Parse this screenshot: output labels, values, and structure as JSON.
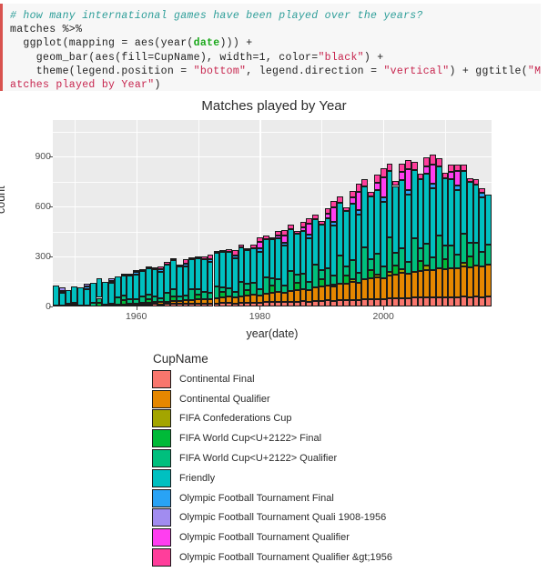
{
  "code": {
    "lines": [
      [
        {
          "t": "# how many international games have been played over the years?",
          "c": "cm"
        }
      ],
      [
        {
          "t": "matches %>%",
          "c": ""
        }
      ],
      [
        {
          "t": "  ggplot(mapping = aes(year(",
          "c": ""
        },
        {
          "t": "date",
          "c": "fn"
        },
        {
          "t": "))) +",
          "c": ""
        }
      ],
      [
        {
          "t": "    geom_bar(aes(fill=CupName), width=1, color=",
          "c": ""
        },
        {
          "t": "\"black\"",
          "c": "st"
        },
        {
          "t": ") +",
          "c": ""
        }
      ],
      [
        {
          "t": "    theme(legend.position = ",
          "c": ""
        },
        {
          "t": "\"bottom\"",
          "c": "st"
        },
        {
          "t": ", legend.direction = ",
          "c": ""
        },
        {
          "t": "\"vertical\"",
          "c": "st"
        },
        {
          "t": ") + ggtitle(",
          "c": ""
        },
        {
          "t": "\"M",
          "c": "st"
        }
      ],
      [
        {
          "t": "atches played by Year\"",
          "c": "st"
        },
        {
          "t": ")",
          "c": ""
        }
      ]
    ]
  },
  "chart_data": {
    "type": "bar",
    "barmode": "stacked",
    "title": "Matches played by Year",
    "xlabel": "year(date)",
    "ylabel": "count",
    "xlim": [
      1946.5,
      2017.5
    ],
    "ylim": [
      0,
      1120
    ],
    "yticks": [
      0,
      300,
      600,
      900
    ],
    "ytick_labels": [
      "0",
      "300",
      "600",
      "900"
    ],
    "xticks": [
      1960,
      1980,
      2000
    ],
    "xtick_labels": [
      "1960",
      "1980",
      "2000"
    ],
    "grid": true,
    "legend_position": "bottom",
    "legend_direction": "vertical",
    "legend_title": "CupName",
    "series": [
      {
        "name": "Continental Final",
        "color": "#F8766D"
      },
      {
        "name": "Continental Qualifier",
        "color": "#E58700"
      },
      {
        "name": "FIFA Confederations Cup",
        "color": "#A3A500"
      },
      {
        "name": "FIFA World Cup<U+2122> Final",
        "color": "#00BA38"
      },
      {
        "name": "FIFA World Cup<U+2122> Qualifier",
        "color": "#00BF7D"
      },
      {
        "name": "Friendly",
        "color": "#00C0C0"
      },
      {
        "name": "Olympic Football Tournament Final",
        "color": "#29A3F5"
      },
      {
        "name": "Olympic Football Tournament Quali 1908-1956",
        "color": "#A18CF0"
      },
      {
        "name": "Olympic Football Tournament Qualifier",
        "color": "#FF3EF0"
      },
      {
        "name": "Olympic Football Tournament Qualifier &gt;1956",
        "color": "#FF3E9B"
      }
    ],
    "categories": [
      1947,
      1948,
      1949,
      1950,
      1951,
      1952,
      1953,
      1954,
      1955,
      1956,
      1957,
      1958,
      1959,
      1960,
      1961,
      1962,
      1963,
      1964,
      1965,
      1966,
      1967,
      1968,
      1969,
      1970,
      1971,
      1972,
      1973,
      1974,
      1975,
      1976,
      1977,
      1978,
      1979,
      1980,
      1981,
      1982,
      1983,
      1984,
      1985,
      1986,
      1987,
      1988,
      1989,
      1990,
      1991,
      1992,
      1993,
      1994,
      1995,
      1996,
      1997,
      1998,
      1999,
      2000,
      2001,
      2002,
      2003,
      2004,
      2005,
      2006,
      2007,
      2008,
      2009,
      2010,
      2011,
      2012,
      2013,
      2014,
      2015,
      2016,
      2017
    ],
    "values": {
      "1947": [
        0,
        0,
        0,
        0,
        6,
        120,
        0,
        0,
        0,
        0
      ],
      "1948": [
        0,
        0,
        0,
        0,
        4,
        80,
        10,
        22,
        0,
        0
      ],
      "1949": [
        0,
        0,
        0,
        4,
        14,
        82,
        0,
        0,
        0,
        0
      ],
      "1950": [
        0,
        0,
        0,
        12,
        8,
        100,
        0,
        0,
        0,
        0
      ],
      "1951": [
        0,
        0,
        0,
        0,
        6,
        108,
        0,
        0,
        0,
        0
      ],
      "1952": [
        0,
        0,
        0,
        0,
        6,
        96,
        18,
        16,
        0,
        0
      ],
      "1953": [
        0,
        0,
        0,
        0,
        22,
        118,
        0,
        0,
        0,
        0
      ],
      "1954": [
        0,
        0,
        0,
        22,
        30,
        120,
        0,
        0,
        0,
        0
      ],
      "1955": [
        0,
        0,
        0,
        0,
        12,
        134,
        0,
        0,
        0,
        0
      ],
      "1956": [
        6,
        0,
        0,
        0,
        10,
        128,
        10,
        14,
        0,
        0
      ],
      "1957": [
        6,
        6,
        0,
        0,
        44,
        122,
        0,
        0,
        0,
        0
      ],
      "1958": [
        8,
        4,
        0,
        28,
        24,
        124,
        0,
        0,
        0,
        4
      ],
      "1959": [
        10,
        6,
        0,
        0,
        28,
        140,
        0,
        0,
        0,
        6
      ],
      "1960": [
        10,
        8,
        0,
        0,
        26,
        150,
        12,
        0,
        0,
        14
      ],
      "1961": [
        12,
        10,
        0,
        0,
        40,
        152,
        0,
        0,
        0,
        8
      ],
      "1962": [
        12,
        10,
        0,
        24,
        26,
        158,
        0,
        0,
        0,
        6
      ],
      "1963": [
        14,
        14,
        0,
        0,
        34,
        164,
        0,
        0,
        0,
        10
      ],
      "1964": [
        12,
        14,
        0,
        0,
        22,
        160,
        16,
        0,
        0,
        18
      ],
      "1965": [
        14,
        16,
        0,
        0,
        52,
        172,
        0,
        0,
        0,
        16
      ],
      "1966": [
        14,
        18,
        0,
        28,
        44,
        176,
        0,
        0,
        0,
        10
      ],
      "1967": [
        16,
        18,
        0,
        0,
        24,
        184,
        0,
        0,
        0,
        12
      ],
      "1968": [
        14,
        22,
        0,
        0,
        28,
        176,
        16,
        0,
        0,
        26
      ],
      "1969": [
        16,
        24,
        0,
        0,
        62,
        180,
        0,
        0,
        0,
        14
      ],
      "1970": [
        16,
        26,
        0,
        28,
        34,
        186,
        0,
        0,
        0,
        8
      ],
      "1971": [
        18,
        28,
        0,
        0,
        40,
        196,
        0,
        0,
        0,
        16
      ],
      "1972": [
        16,
        30,
        0,
        0,
        34,
        188,
        16,
        0,
        0,
        30
      ],
      "1973": [
        18,
        32,
        0,
        0,
        70,
        200,
        0,
        0,
        0,
        14
      ],
      "1974": [
        20,
        34,
        0,
        32,
        30,
        210,
        0,
        0,
        0,
        10
      ],
      "1975": [
        20,
        38,
        0,
        0,
        52,
        216,
        0,
        0,
        0,
        18
      ],
      "1976": [
        18,
        36,
        0,
        0,
        34,
        200,
        16,
        0,
        0,
        34
      ],
      "1977": [
        22,
        40,
        0,
        0,
        86,
        208,
        0,
        0,
        0,
        18
      ],
      "1978": [
        22,
        42,
        0,
        32,
        38,
        206,
        0,
        0,
        0,
        12
      ],
      "1979": [
        24,
        46,
        0,
        0,
        70,
        212,
        0,
        0,
        0,
        22
      ],
      "1980": [
        22,
        44,
        0,
        0,
        40,
        224,
        18,
        0,
        40,
        26
      ],
      "1981": [
        26,
        50,
        0,
        0,
        98,
        230,
        0,
        0,
        0,
        20
      ],
      "1982": [
        26,
        54,
        0,
        44,
        44,
        236,
        0,
        0,
        0,
        14
      ],
      "1983": [
        28,
        58,
        0,
        0,
        80,
        244,
        0,
        0,
        18,
        24
      ],
      "1984": [
        26,
        56,
        0,
        0,
        46,
        238,
        18,
        0,
        44,
        30
      ],
      "1985": [
        30,
        64,
        0,
        0,
        118,
        252,
        0,
        0,
        0,
        26
      ],
      "1986": [
        30,
        68,
        0,
        44,
        48,
        248,
        0,
        0,
        0,
        18
      ],
      "1987": [
        32,
        72,
        0,
        0,
        94,
        256,
        0,
        0,
        24,
        28
      ],
      "1988": [
        30,
        70,
        0,
        0,
        50,
        260,
        20,
        0,
        66,
        34
      ],
      "1989": [
        34,
        80,
        0,
        0,
        140,
        270,
        0,
        0,
        0,
        30
      ],
      "1990": [
        34,
        84,
        0,
        46,
        52,
        276,
        0,
        0,
        0,
        20
      ],
      "1991": [
        36,
        88,
        0,
        0,
        108,
        296,
        0,
        0,
        30,
        34
      ],
      "1992": [
        34,
        86,
        12,
        0,
        56,
        300,
        22,
        0,
        86,
        40
      ],
      "1993": [
        38,
        96,
        0,
        0,
        170,
        320,
        0,
        0,
        0,
        36
      ],
      "1994": [
        38,
        100,
        0,
        46,
        58,
        330,
        0,
        0,
        0,
        24
      ],
      "1995": [
        40,
        106,
        16,
        0,
        116,
        340,
        0,
        0,
        36,
        40
      ],
      "1996": [
        38,
        104,
        0,
        0,
        62,
        350,
        24,
        0,
        112,
        46
      ],
      "1997": [
        44,
        120,
        0,
        0,
        190,
        368,
        0,
        0,
        0,
        42
      ],
      "1998": [
        44,
        124,
        0,
        52,
        66,
        376,
        0,
        0,
        0,
        28
      ],
      "1999": [
        46,
        130,
        18,
        0,
        124,
        384,
        0,
        0,
        40,
        48
      ],
      "2000": [
        44,
        128,
        0,
        0,
        70,
        388,
        26,
        0,
        120,
        52
      ],
      "2001": [
        48,
        140,
        20,
        0,
        206,
        400,
        0,
        0,
        0,
        46
      ],
      "2002": [
        48,
        144,
        0,
        56,
        72,
        404,
        0,
        0,
        0,
        30
      ],
      "2003": [
        50,
        150,
        22,
        0,
        130,
        410,
        0,
        0,
        44,
        50
      ],
      "2004": [
        48,
        148,
        0,
        0,
        74,
        404,
        26,
        0,
        124,
        54
      ],
      "2005": [
        52,
        158,
        0,
        0,
        200,
        412,
        0,
        0,
        0,
        48
      ],
      "2006": [
        52,
        162,
        0,
        58,
        76,
        416,
        0,
        0,
        0,
        32
      ],
      "2007": [
        54,
        166,
        24,
        0,
        134,
        420,
        0,
        0,
        46,
        52
      ],
      "2008": [
        52,
        164,
        0,
        0,
        78,
        414,
        28,
        0,
        118,
        56
      ],
      "2009": [
        56,
        172,
        0,
        0,
        196,
        418,
        0,
        0,
        0,
        50
      ],
      "2010": [
        54,
        170,
        0,
        60,
        80,
        404,
        0,
        0,
        0,
        34
      ],
      "2011": [
        56,
        176,
        0,
        0,
        136,
        398,
        0,
        0,
        44,
        44
      ],
      "2012": [
        54,
        174,
        0,
        0,
        82,
        390,
        28,
        0,
        84,
        40
      ],
      "2013": [
        58,
        182,
        24,
        0,
        172,
        380,
        0,
        0,
        0,
        38
      ],
      "2014": [
        56,
        180,
        0,
        62,
        84,
        364,
        0,
        0,
        0,
        26
      ],
      "2015": [
        58,
        186,
        0,
        0,
        140,
        350,
        0,
        0,
        0,
        30
      ],
      "2016": [
        56,
        184,
        0,
        0,
        86,
        332,
        26,
        0,
        0,
        28
      ],
      "2017": [
        60,
        190,
        0,
        0,
        124,
        300,
        0,
        0,
        0,
        0
      ]
    }
  }
}
